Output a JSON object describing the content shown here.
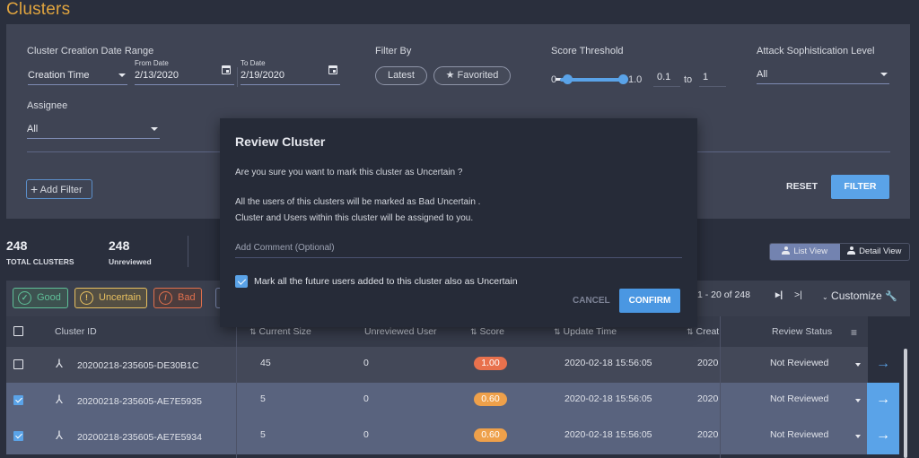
{
  "page": {
    "title": "Clusters"
  },
  "filters": {
    "date_range": {
      "label": "Cluster Creation Date Range",
      "type_value": "Creation Time",
      "from_label": "From Date",
      "from_value": "2/13/2020",
      "to_label": "To Date",
      "to_value": "2/19/2020"
    },
    "filter_by": {
      "label": "Filter By",
      "latest": "Latest",
      "favorited": "Favorited"
    },
    "score_threshold": {
      "label": "Score Threshold",
      "min_label": "0",
      "max_label": "1.0",
      "from_value": "0.1",
      "to_label": "to",
      "to_value": "1",
      "range": [
        0.1,
        1.0
      ]
    },
    "attack_level": {
      "label": "Attack Sophistication Level",
      "value": "All"
    },
    "assignee": {
      "label": "Assignee",
      "value": "All"
    },
    "add_filter": "Add Filter",
    "reset": "RESET",
    "filter": "FILTER"
  },
  "stats": [
    {
      "value": "248",
      "label": "TOTAL CLUSTERS"
    },
    {
      "value": "248",
      "label": "Unreviewed"
    }
  ],
  "view_toggle": {
    "list": "List View",
    "detail": "Detail View",
    "active": "list"
  },
  "actions": {
    "good": "Good",
    "uncertain": "Uncertain",
    "bad": "Bad"
  },
  "pagination": {
    "range": "1 - 20 of 248",
    "customize": "Customize"
  },
  "table": {
    "headers": {
      "cluster_id": "Cluster ID",
      "current_size": "Current Size",
      "unreviewed_user": "Unreviewed User",
      "score": "Score",
      "update_time": "Update Time",
      "create_time": "Creat",
      "review_status": "Review Status"
    },
    "rows": [
      {
        "id": "20200218-235605-DE30B1C",
        "size": "45",
        "unreviewed": "0",
        "score": "1.00",
        "score_color": "#e8714d",
        "update": "2020-02-18 15:56:05",
        "create": "2020",
        "status": "Not Reviewed",
        "selected": false
      },
      {
        "id": "20200218-235605-AE7E5935",
        "size": "5",
        "unreviewed": "0",
        "score": "0.60",
        "score_color": "#eea04a",
        "update": "2020-02-18 15:56:05",
        "create": "2020",
        "status": "Not Reviewed",
        "selected": true
      },
      {
        "id": "20200218-235605-AE7E5934",
        "size": "5",
        "unreviewed": "0",
        "score": "0.60",
        "score_color": "#eea04a",
        "update": "2020-02-18 15:56:05",
        "create": "2020",
        "status": "Not Reviewed",
        "selected": true
      }
    ]
  },
  "modal": {
    "title": "Review Cluster",
    "question": "Are you sure you want to mark this cluster as Uncertain ?",
    "line1": "All the users of this clusters will be marked as Bad Uncertain .",
    "line2": "Cluster and Users within this cluster will be assigned to you.",
    "comment_placeholder": "Add Comment (Optional)",
    "checkbox_label": "Mark all the future users added to this cluster also as Uncertain",
    "checkbox_checked": true,
    "cancel": "CANCEL",
    "confirm": "CONFIRM"
  },
  "colors": {
    "accent": "#5aa3e8",
    "title": "#e0a43f",
    "good": "#5fbf98",
    "uncertain": "#e8c060",
    "bad": "#e0704d"
  }
}
